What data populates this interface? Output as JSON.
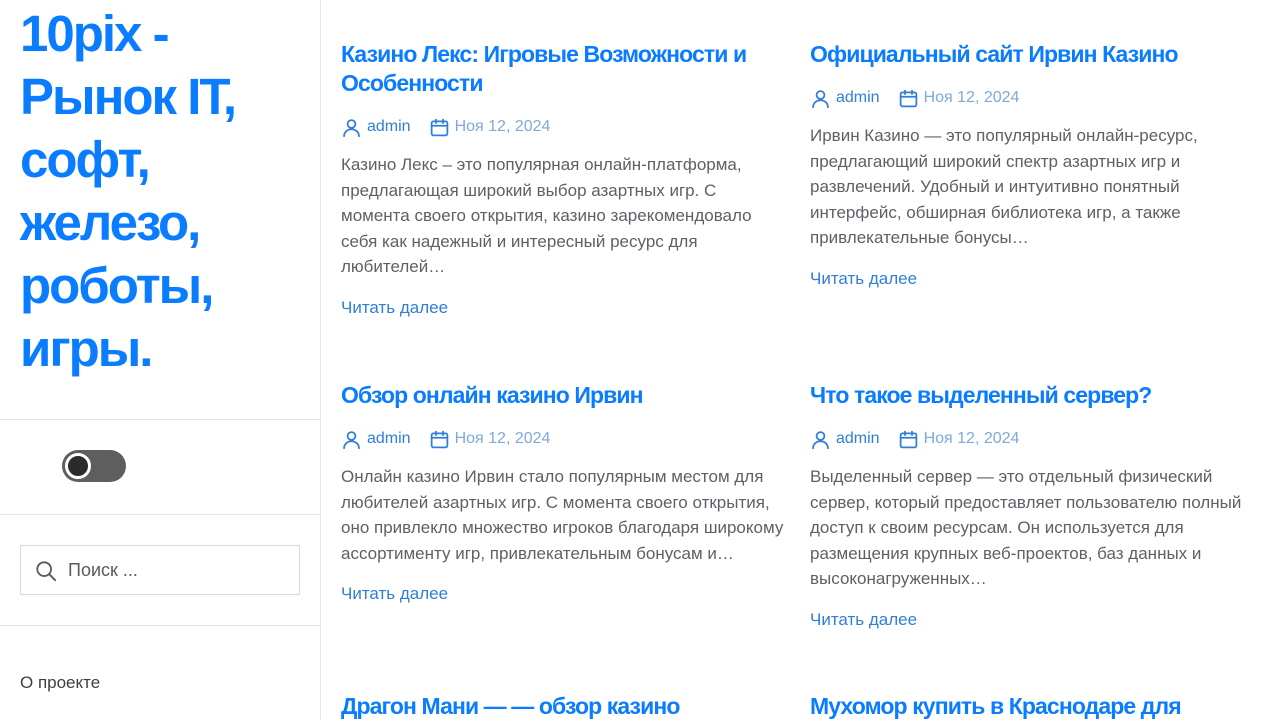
{
  "site": {
    "title": "10pix - Рынок IT, софт, железо, роботы, игры."
  },
  "search": {
    "placeholder": "Поиск ..."
  },
  "menu": {
    "items": [
      "О проекте"
    ]
  },
  "colors": {
    "accent": "#0a7cff",
    "link": "#2f7ed8",
    "date": "#7fa9d9",
    "text": "#5c6167",
    "toggle": "#5e5e5e"
  },
  "read_more_label": "Читать далее",
  "posts": [
    {
      "title": "Казино Лекс: Игровые Возможности и Особенности",
      "author": "admin",
      "date": "Ноя 12, 2024",
      "excerpt": "Казино Лекс – это популярная онлайн-платформа, предлагающая широкий выбор азартных игр. С момента своего открытия, казино зарекомендовало себя как надежный и интересный ресурс для любителей…"
    },
    {
      "title": "Официальный сайт Ирвин Казино",
      "author": "admin",
      "date": "Ноя 12, 2024",
      "excerpt": "Ирвин Казино — это популярный онлайн-ресурс, предлагающий широкий спектр азартных игр и развлечений. Удобный и интуитивно понятный интерфейс, обширная библиотека игр, а также привлекательные бонусы…"
    },
    {
      "title": "Обзор онлайн казино Ирвин",
      "author": "admin",
      "date": "Ноя 12, 2024",
      "excerpt": "Онлайн казино Ирвин стало популярным местом для любителей азартных игр. С момента своего открытия, оно привлекло множество игроков благодаря широкому ассортименту игр, привлекательным бонусам и…"
    },
    {
      "title": "Что такое выделенный сервер?",
      "author": "admin",
      "date": "Ноя 12, 2024",
      "excerpt": "Выделенный сервер — это отдельный физический сервер, который предоставляет пользователю полный доступ к своим ресурсам. Он используется для размещения крупных веб-проектов, баз данных и высоконагруженных…"
    },
    {
      "title": "Драгон Мани — — обзор казино"
    },
    {
      "title": "Мухомор купить в Краснодаре для"
    }
  ]
}
